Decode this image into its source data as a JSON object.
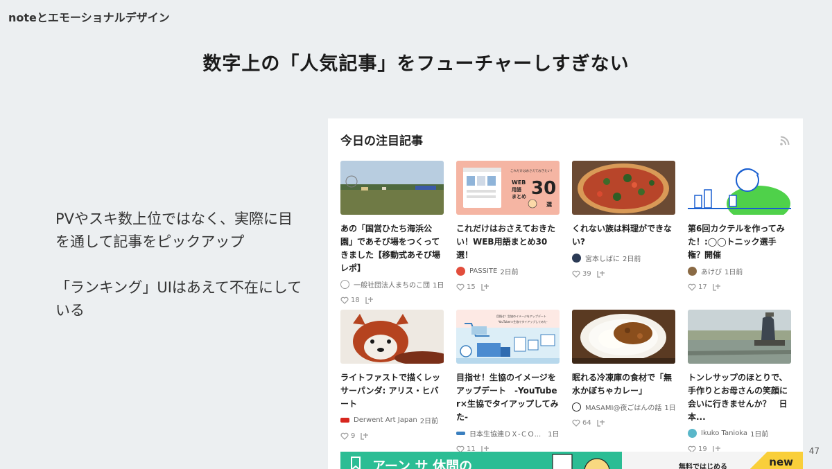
{
  "header": {
    "title": "noteとエモーショナルデザイン"
  },
  "slide_title": "数字上の「人気記事」をフューチャーしすぎない",
  "left_text": {
    "p1": "PVやスキ数上位ではなく、実際に目を通して記事をピックアップ",
    "p2": "「ランキング」UIはあえて不在にしている"
  },
  "page_number": "47",
  "panel": {
    "title": "今日の注目記事",
    "rss_icon": "rss-icon",
    "articles": [
      {
        "title": "あの「国営ひたち海浜公園」であそび場をつくってきました【移動式あそび場レポ】",
        "author": "一般社団法人まちのこ団",
        "time": "1日前",
        "likes": "18"
      },
      {
        "title": "これだけはおさえておきたい！WEB用語まとめ30選！",
        "author": "PASSITE",
        "time": "2日前",
        "likes": "15"
      },
      {
        "title": "くれない族は料理ができない?",
        "author": "宮本しばに",
        "time": "2日前",
        "likes": "39"
      },
      {
        "title": "第6回カクテルを作ってみた！:◯◯トニック選手権？開催",
        "author": "あけび",
        "time": "1日前",
        "likes": "17"
      },
      {
        "title": "ライトファストで描くレッサーパンダ: アリス・ヒバート",
        "author": "Derwent Art Japan",
        "time": "2日前",
        "likes": "9"
      },
      {
        "title": "目指せ！生協のイメージをアップデート　-YouTuber×生協でタイアップしてみた-",
        "author": "日本生協連ＤＸ-ＣＯ...",
        "time": "1日前",
        "likes": "11"
      },
      {
        "title": "眠れる冷凍庫の食材で「無水かぼちゃカレー」",
        "author": "MASAMI@夜ごはんの話",
        "time": "1日前",
        "likes": "64"
      },
      {
        "title": "トンレサップのほとりで、手作りとお母さんの笑顔に会いに行きませんか？　日本...",
        "author": "Ikuko Tanioka",
        "time": "1日前",
        "likes": "19"
      }
    ],
    "thumb2": {
      "small": "これだけはおさえておきたい！",
      "main": "WEB\n用語\nまとめ",
      "num": "30",
      "sen": "選"
    },
    "thumb6": {
      "line1": "目指せ！生協のイメージをアップデート",
      "line2": "-YouTuber×生協でタイアップしてみた-"
    },
    "banner": {
      "left": "アーン サ 休問の",
      "right": "無料ではじめる",
      "badge": "new"
    }
  },
  "colors": {
    "background": "#eceff1",
    "accent_green": "#2bbd94",
    "badge_yellow": "#f9cf3a"
  }
}
